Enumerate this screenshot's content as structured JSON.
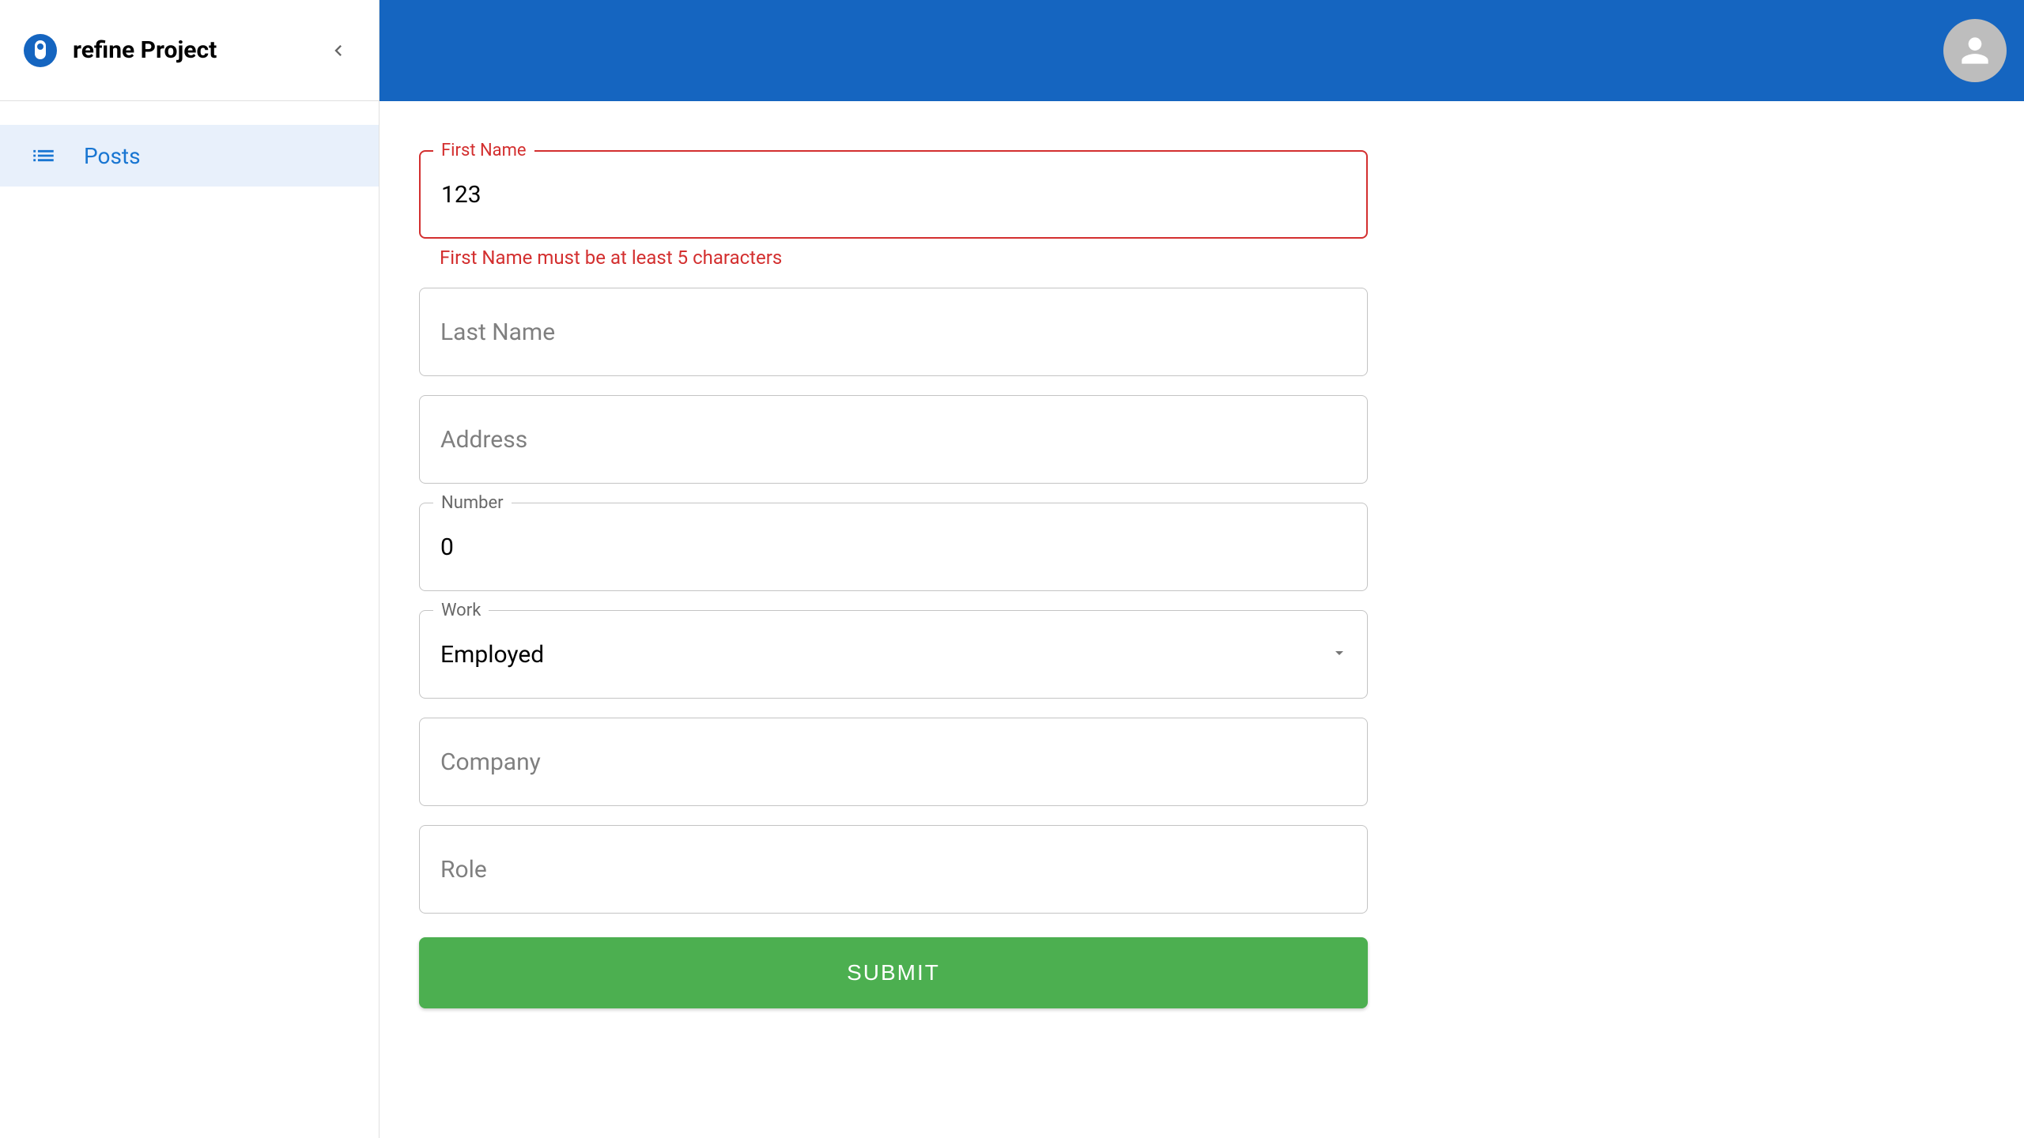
{
  "sidebar": {
    "title": "refine Project",
    "items": [
      {
        "label": "Posts"
      }
    ]
  },
  "form": {
    "firstName": {
      "label": "First Name",
      "value": "123",
      "error": "First Name must be at least 5 characters"
    },
    "lastName": {
      "label": "Last Name",
      "value": ""
    },
    "address": {
      "label": "Address",
      "value": ""
    },
    "number": {
      "label": "Number",
      "value": "0"
    },
    "work": {
      "label": "Work",
      "value": "Employed"
    },
    "company": {
      "label": "Company",
      "value": ""
    },
    "role": {
      "label": "Role",
      "value": ""
    },
    "submitLabel": "SUBMIT"
  }
}
